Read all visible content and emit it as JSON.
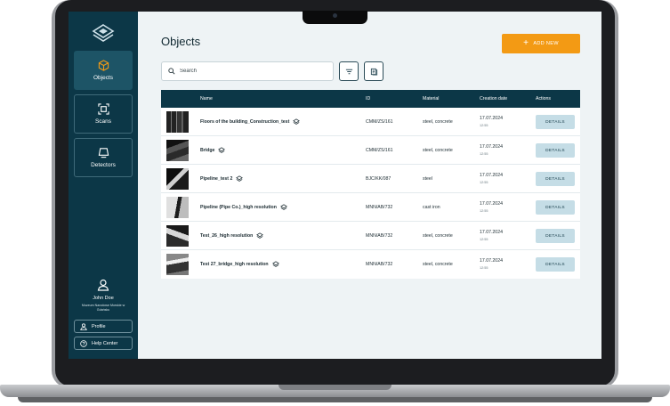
{
  "sidebar": {
    "nav": [
      {
        "label": "Objects",
        "icon": "cube-icon"
      },
      {
        "label": "Scans",
        "icon": "scan-icon"
      },
      {
        "label": "Detectors",
        "icon": "detector-icon"
      }
    ],
    "user": {
      "name": "John Doe",
      "org": "Muzeum Narodowe Morskie w Gdańsku"
    },
    "profile_label": "Profile",
    "help_label": "Help Center"
  },
  "main": {
    "title": "Objects",
    "add_label": "ADD NEW",
    "search_placeholder": "Search",
    "columns": {
      "name": "Name",
      "id": "ID",
      "material": "Material",
      "date": "Creation date",
      "actions": "Actions"
    },
    "details_label": "DETAILS",
    "rows": [
      {
        "name": "Floors of the building_Construction_test",
        "id": "CMM/ZS/161",
        "material": "steel, concrete",
        "date": "17.07.2024",
        "time": "12:55"
      },
      {
        "name": "Bridge",
        "id": "CMM/ZS/161",
        "material": "steel, concrete",
        "date": "17.07.2024",
        "time": "12:55"
      },
      {
        "name": "Pipeline_test 2",
        "id": "BJC/KK/087",
        "material": "steel",
        "date": "17.07.2024",
        "time": "12:55"
      },
      {
        "name": "Pipeline (Pipe Co.)_high resolution",
        "id": "MNN/AB/732",
        "material": "cast iron",
        "date": "17.07.2024",
        "time": "12:55"
      },
      {
        "name": "Test_26_high resolution",
        "id": "MNN/AB/732",
        "material": "steel, concrete",
        "date": "17.07.2024",
        "time": "12:55"
      },
      {
        "name": "Test 27_bridge_high resolution",
        "id": "MNN/AB/732",
        "material": "steel, concrete",
        "date": "17.07.2024",
        "time": "12:55"
      }
    ]
  },
  "colors": {
    "sidebar": "#0c3747",
    "accent": "#f39a14",
    "details_button": "#c5dde6",
    "background": "#eef3f5"
  }
}
